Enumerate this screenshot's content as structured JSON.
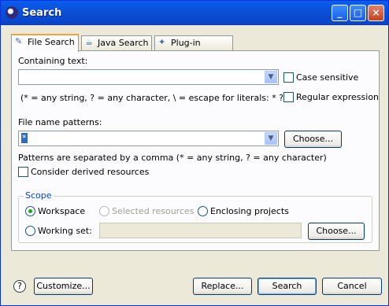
{
  "window": {
    "title": "Search",
    "controls": {
      "minimize": "_",
      "maximize": "□",
      "close": "×"
    }
  },
  "tabs": [
    {
      "label": "File Search",
      "icon": "file-search-icon",
      "active": true
    },
    {
      "label": "Java Search",
      "icon": "java-search-icon",
      "active": false
    },
    {
      "label": "Plug-in Search",
      "icon": "plugin-search-icon",
      "active": false
    }
  ],
  "containing_text": {
    "label": "Containing text:",
    "value": "",
    "hint": "(* = any string, ? = any character, \\ = escape for literals: * ? \\)",
    "case_sensitive_label": "Case sensitive",
    "regex_label": "Regular expression",
    "case_sensitive_checked": false,
    "regex_checked": false
  },
  "file_name_patterns": {
    "label": "File name patterns:",
    "value": "*",
    "choose_label": "Choose...",
    "hint": "Patterns are separated by a comma (* = any string, ? = any character)",
    "derived_label": "Consider derived resources",
    "derived_checked": false
  },
  "scope": {
    "title": "Scope",
    "workspace_label": "Workspace",
    "selected_label": "Selected resources",
    "enclosing_label": "Enclosing projects",
    "working_set_label": "Working set:",
    "working_set_value": "",
    "choose_label": "Choose...",
    "selected": "Workspace"
  },
  "footer": {
    "help_icon": "?",
    "customize_label": "Customize...",
    "replace_label": "Replace...",
    "search_label": "Search",
    "cancel_label": "Cancel"
  }
}
